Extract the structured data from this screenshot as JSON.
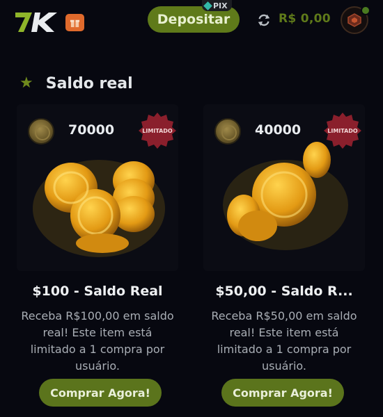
{
  "header": {
    "logo_text": "7K",
    "gift_icon": "gift-icon",
    "deposit_label": "Depositar",
    "pix_label": "PIX",
    "refresh_icon": "refresh-icon",
    "balance": "R$ 0,00",
    "avatar_icon": "rank-avatar-icon"
  },
  "section": {
    "icon": "star-icon",
    "title": "Saldo real"
  },
  "cards": [
    {
      "coin_amount": "70000",
      "badge": "LIMITADO",
      "title": "$100 - Saldo Real",
      "description": "Receba R$100,00 em saldo real! Este item está limitado a 1 compra por usuário.",
      "button": "Comprar Agora!"
    },
    {
      "coin_amount": "40000",
      "badge": "LIMITADO",
      "title": "$50,00 - Saldo R...",
      "description": "Receba R$50,00 em saldo real! Este item está limitado a 1 compra por usuário.",
      "button": "Comprar Agora!"
    }
  ],
  "colors": {
    "accent_green": "#5f7a1a",
    "badge_red": "#8a1f2c",
    "background": "#070810",
    "coin_gold": "#e0a520"
  }
}
